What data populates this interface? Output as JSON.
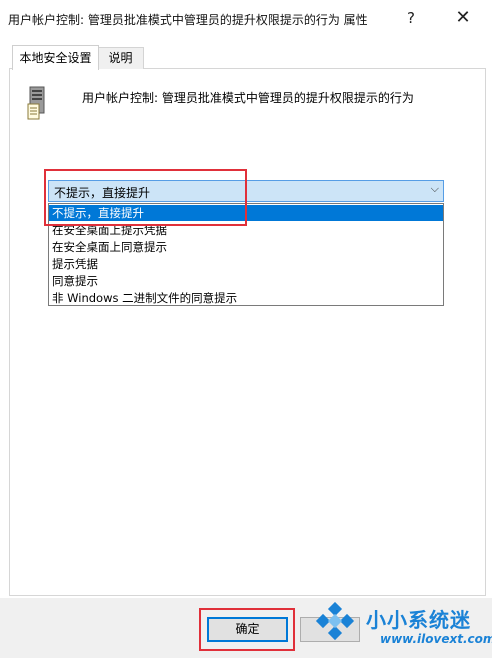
{
  "window": {
    "title": "用户帐户控制: 管理员批准模式中管理员的提升权限提示的行为 属性",
    "help_glyph": "?",
    "close_glyph": "✕"
  },
  "tabs": [
    {
      "label": "本地安全设置",
      "active": true
    },
    {
      "label": "说明",
      "active": false
    }
  ],
  "policy": {
    "name": "用户帐户控制: 管理员批准模式中管理员的提升权限提示的行为",
    "icon": "server-policy-icon"
  },
  "combobox": {
    "value": "不提示，直接提升",
    "arrow_glyph": "⌵",
    "options": [
      "不提示，直接提升",
      "在安全桌面上提示凭据",
      "在安全桌面上同意提示",
      "提示凭据",
      "同意提示",
      "非 Windows 二进制文件的同意提示"
    ],
    "selected_index": 0
  },
  "footer": {
    "ok_label": "确定"
  },
  "watermark": {
    "brand": "小小系统迷",
    "url": "www.ilovext.com"
  },
  "colors": {
    "highlight": "#e0303a",
    "selection": "#0078d7",
    "combo_bg": "#cce4f7",
    "watermark": "#1a82d6"
  }
}
